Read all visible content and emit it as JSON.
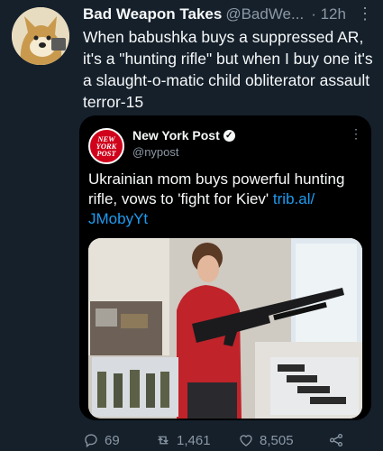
{
  "tweet": {
    "author_name": "Bad Weapon Takes",
    "author_handle": "@BadWe...",
    "time": "· 12h",
    "text": "When babushka buys a suppressed AR, it's a \"hunting rifle\" but when I buy one it's a slaught-o-matic child obliterator assault terror-15"
  },
  "quote": {
    "logo_text": "NEW YORK POST",
    "name": "New York Post",
    "handle": "@nypost",
    "text": "Ukrainian mom buys powerful hunting rifle, vows to 'fight for Kiev'",
    "link": "trib.al/ JMobyYt"
  },
  "actions": {
    "replies": "69",
    "retweets": "1,461",
    "likes": "8,505"
  },
  "icons": [
    "more-icon",
    "verified-icon",
    "reply-icon",
    "retweet-icon",
    "like-icon",
    "share-icon"
  ],
  "colors": {
    "background": "#15202b",
    "link": "#1d9bf0",
    "muted": "#8b98a5",
    "nypost_red": "#d0021b"
  }
}
